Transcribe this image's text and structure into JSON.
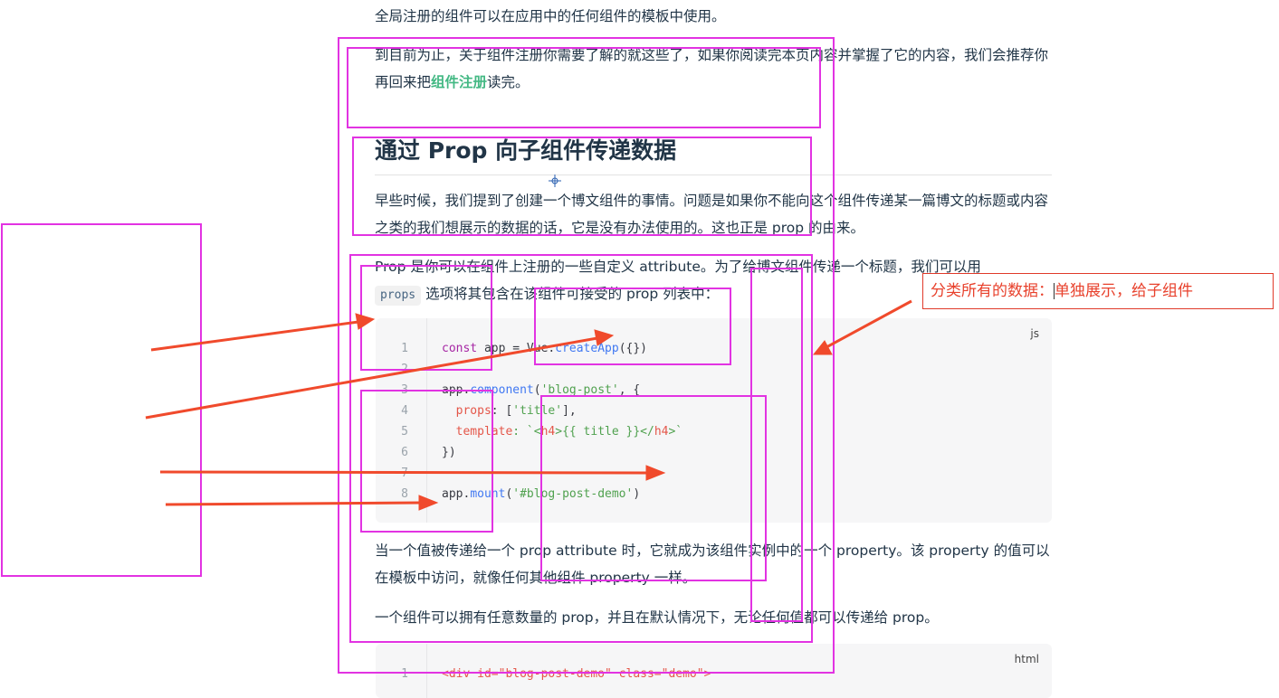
{
  "doc": {
    "line_top": "全局注册的组件可以在应用中的任何组件的模板中使用。",
    "para1_a": "到目前为止，关于组件注册你需要了解的就这些了，如果你阅读完本页内容并掌握了它的内容，我们会推荐你再回来把",
    "para1_link": "组件注册",
    "para1_b": "读完。",
    "heading": "通过 Prop 向子组件传递数据",
    "para2": "早些时候，我们提到了创建一个博文组件的事情。问题是如果你不能向这个组件传递某一篇博文的标题或内容之类的我们想展示的数据的话，它是没有办法使用的。这也正是 prop 的由来。",
    "para3_a": "Prop 是你可以在组件上注册的一些自定义 attribute。为了给博文组件传递一个标题，我们可以用",
    "para3_code": "props",
    "para3_b": "选项将其包含在该组件可接受的 prop 列表中：",
    "para4": "当一个值被传递给一个 prop attribute 时，它就成为该组件实例中的一个 property。该 property 的值可以在模板中访问，就像任何其他组件 property 一样。",
    "para5": "一个组件可以拥有任意数量的 prop，并且在默认情况下，无论任何值都可以传递给 prop。"
  },
  "code1": {
    "lang": "js",
    "line_numbers": [
      "1",
      "2",
      "3",
      "4",
      "5",
      "6",
      "7",
      "8"
    ],
    "l1_a": "const",
    "l1_b": " app = Vue.",
    "l1_c": "createApp",
    "l1_d": "({})",
    "l3_a": "app.",
    "l3_b": "component",
    "l3_c": "(",
    "l3_d": "'blog-post'",
    "l3_e": ", {",
    "l4_a": "  props",
    "l4_b": ": [",
    "l4_c": "'title'",
    "l4_d": "],",
    "l5_a": "  template",
    "l5_b": ": `<",
    "l5_c": "h4",
    "l5_d": ">{{ title }}</",
    "l5_e": "h4",
    "l5_f": ">`",
    "l6": "})",
    "l8_a": "app.",
    "l8_b": "mount",
    "l8_c": "(",
    "l8_d": "'#blog-post-demo'",
    "l8_e": ")"
  },
  "code2": {
    "lang": "html",
    "line1_num": "1",
    "line1": "<div id=\"blog-post-demo\" class=\"demo\">"
  },
  "annotation": {
    "note_a": "分类所有的数据：",
    "note_b": "单独展示，给子组件"
  },
  "colors": {
    "highlight_box": "#e233e2",
    "arrow": "#f04a2c",
    "link": "#42b883"
  },
  "icons": {
    "cursor": "crosshair-cursor-icon"
  }
}
